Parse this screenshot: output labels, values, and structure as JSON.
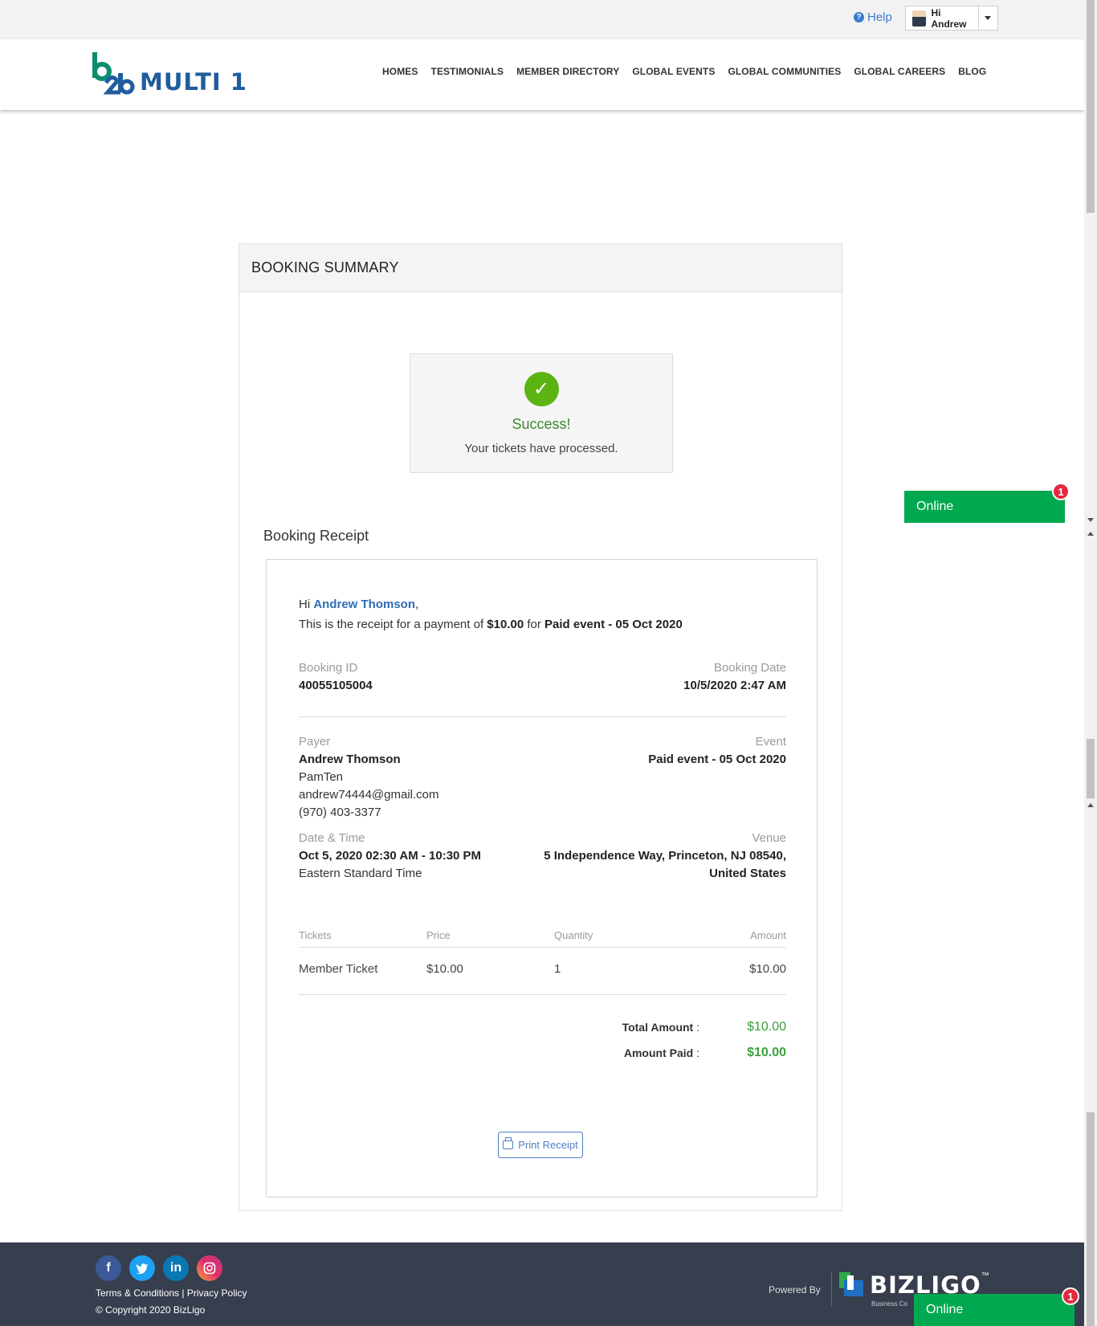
{
  "topbar": {
    "help_label": "Help",
    "user_greeting": "Hi Andrew"
  },
  "header": {
    "logo_text": "MULTI 1",
    "nav": [
      "HOMES",
      "TESTIMONIALS",
      "MEMBER DIRECTORY",
      "GLOBAL EVENTS",
      "GLOBAL COMMUNITIES",
      "GLOBAL CAREERS",
      "BLOG"
    ]
  },
  "panel": {
    "title": "BOOKING SUMMARY",
    "success_title": "Success!",
    "success_message": "Your tickets have processed.",
    "receipt_heading": "Booking Receipt"
  },
  "receipt": {
    "greeting_prefix": "Hi",
    "payer_name_link": "Andrew Thomson",
    "greeting_suffix": ",",
    "line_prefix": "This is the receipt for a payment of",
    "line_amount": "$10.00",
    "line_for": "for",
    "line_event": "Paid event - 05 Oct 2020",
    "booking_id_label": "Booking ID",
    "booking_id": "40055105004",
    "booking_date_label": "Booking Date",
    "booking_date": "10/5/2020 2:47 AM",
    "payer_label": "Payer",
    "payer_name": "Andrew Thomson",
    "payer_company": "PamTen",
    "payer_email": "andrew74444@gmail.com",
    "payer_phone": "(970) 403-3377",
    "event_label": "Event",
    "event_name": "Paid event - 05 Oct 2020",
    "datetime_label": "Date & Time",
    "datetime": "Oct 5, 2020 02:30 AM - 10:30 PM",
    "timezone": "Eastern Standard Time",
    "venue_label": "Venue",
    "venue_line1": "5 Independence Way, Princeton, NJ 08540,",
    "venue_line2": "United States",
    "table": {
      "headers": [
        "Tickets",
        "Price",
        "Quantity",
        "Amount"
      ],
      "rows": [
        [
          "Member Ticket",
          "$10.00",
          "1",
          "$10.00"
        ]
      ]
    },
    "total_amount_label": "Total Amount",
    "total_amount": "$10.00",
    "amount_paid_label": "Amount Paid",
    "amount_paid": "$10.00",
    "colon": ":",
    "print_label": "Print Receipt"
  },
  "chat": {
    "online_label": "Online",
    "badge_count": "1"
  },
  "footer": {
    "terms": "Terms & Conditions",
    "separator": "|",
    "privacy": "Privacy Policy",
    "copyright": "© Copyright 2020 BizLigo",
    "powered_by": "Powered By",
    "brand": "BIZLIGO",
    "brand_tm": "™",
    "brand_sub": "Business Co"
  },
  "colors": {
    "accent_blue": "#2e6db4",
    "success_green": "#5bb412",
    "online_green": "#00a94f",
    "footer_bg": "#373e4e",
    "badge_red": "#e4283f"
  }
}
